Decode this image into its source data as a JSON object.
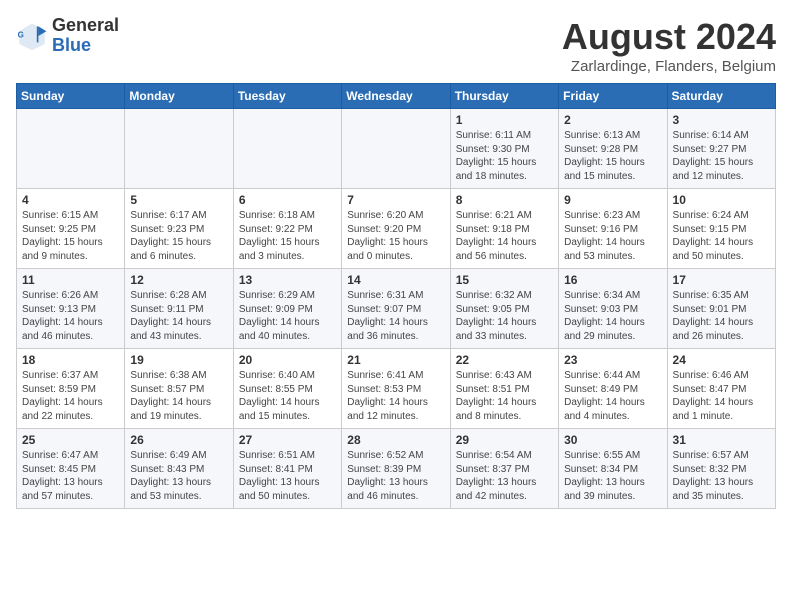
{
  "header": {
    "logo_general": "General",
    "logo_blue": "Blue",
    "month_year": "August 2024",
    "location": "Zarlardinge, Flanders, Belgium"
  },
  "weekdays": [
    "Sunday",
    "Monday",
    "Tuesday",
    "Wednesday",
    "Thursday",
    "Friday",
    "Saturday"
  ],
  "weeks": [
    [
      {
        "day": "",
        "info": ""
      },
      {
        "day": "",
        "info": ""
      },
      {
        "day": "",
        "info": ""
      },
      {
        "day": "",
        "info": ""
      },
      {
        "day": "1",
        "info": "Sunrise: 6:11 AM\nSunset: 9:30 PM\nDaylight: 15 hours and 18 minutes."
      },
      {
        "day": "2",
        "info": "Sunrise: 6:13 AM\nSunset: 9:28 PM\nDaylight: 15 hours and 15 minutes."
      },
      {
        "day": "3",
        "info": "Sunrise: 6:14 AM\nSunset: 9:27 PM\nDaylight: 15 hours and 12 minutes."
      }
    ],
    [
      {
        "day": "4",
        "info": "Sunrise: 6:15 AM\nSunset: 9:25 PM\nDaylight: 15 hours and 9 minutes."
      },
      {
        "day": "5",
        "info": "Sunrise: 6:17 AM\nSunset: 9:23 PM\nDaylight: 15 hours and 6 minutes."
      },
      {
        "day": "6",
        "info": "Sunrise: 6:18 AM\nSunset: 9:22 PM\nDaylight: 15 hours and 3 minutes."
      },
      {
        "day": "7",
        "info": "Sunrise: 6:20 AM\nSunset: 9:20 PM\nDaylight: 15 hours and 0 minutes."
      },
      {
        "day": "8",
        "info": "Sunrise: 6:21 AM\nSunset: 9:18 PM\nDaylight: 14 hours and 56 minutes."
      },
      {
        "day": "9",
        "info": "Sunrise: 6:23 AM\nSunset: 9:16 PM\nDaylight: 14 hours and 53 minutes."
      },
      {
        "day": "10",
        "info": "Sunrise: 6:24 AM\nSunset: 9:15 PM\nDaylight: 14 hours and 50 minutes."
      }
    ],
    [
      {
        "day": "11",
        "info": "Sunrise: 6:26 AM\nSunset: 9:13 PM\nDaylight: 14 hours and 46 minutes."
      },
      {
        "day": "12",
        "info": "Sunrise: 6:28 AM\nSunset: 9:11 PM\nDaylight: 14 hours and 43 minutes."
      },
      {
        "day": "13",
        "info": "Sunrise: 6:29 AM\nSunset: 9:09 PM\nDaylight: 14 hours and 40 minutes."
      },
      {
        "day": "14",
        "info": "Sunrise: 6:31 AM\nSunset: 9:07 PM\nDaylight: 14 hours and 36 minutes."
      },
      {
        "day": "15",
        "info": "Sunrise: 6:32 AM\nSunset: 9:05 PM\nDaylight: 14 hours and 33 minutes."
      },
      {
        "day": "16",
        "info": "Sunrise: 6:34 AM\nSunset: 9:03 PM\nDaylight: 14 hours and 29 minutes."
      },
      {
        "day": "17",
        "info": "Sunrise: 6:35 AM\nSunset: 9:01 PM\nDaylight: 14 hours and 26 minutes."
      }
    ],
    [
      {
        "day": "18",
        "info": "Sunrise: 6:37 AM\nSunset: 8:59 PM\nDaylight: 14 hours and 22 minutes."
      },
      {
        "day": "19",
        "info": "Sunrise: 6:38 AM\nSunset: 8:57 PM\nDaylight: 14 hours and 19 minutes."
      },
      {
        "day": "20",
        "info": "Sunrise: 6:40 AM\nSunset: 8:55 PM\nDaylight: 14 hours and 15 minutes."
      },
      {
        "day": "21",
        "info": "Sunrise: 6:41 AM\nSunset: 8:53 PM\nDaylight: 14 hours and 12 minutes."
      },
      {
        "day": "22",
        "info": "Sunrise: 6:43 AM\nSunset: 8:51 PM\nDaylight: 14 hours and 8 minutes."
      },
      {
        "day": "23",
        "info": "Sunrise: 6:44 AM\nSunset: 8:49 PM\nDaylight: 14 hours and 4 minutes."
      },
      {
        "day": "24",
        "info": "Sunrise: 6:46 AM\nSunset: 8:47 PM\nDaylight: 14 hours and 1 minute."
      }
    ],
    [
      {
        "day": "25",
        "info": "Sunrise: 6:47 AM\nSunset: 8:45 PM\nDaylight: 13 hours and 57 minutes."
      },
      {
        "day": "26",
        "info": "Sunrise: 6:49 AM\nSunset: 8:43 PM\nDaylight: 13 hours and 53 minutes."
      },
      {
        "day": "27",
        "info": "Sunrise: 6:51 AM\nSunset: 8:41 PM\nDaylight: 13 hours and 50 minutes."
      },
      {
        "day": "28",
        "info": "Sunrise: 6:52 AM\nSunset: 8:39 PM\nDaylight: 13 hours and 46 minutes."
      },
      {
        "day": "29",
        "info": "Sunrise: 6:54 AM\nSunset: 8:37 PM\nDaylight: 13 hours and 42 minutes."
      },
      {
        "day": "30",
        "info": "Sunrise: 6:55 AM\nSunset: 8:34 PM\nDaylight: 13 hours and 39 minutes."
      },
      {
        "day": "31",
        "info": "Sunrise: 6:57 AM\nSunset: 8:32 PM\nDaylight: 13 hours and 35 minutes."
      }
    ]
  ]
}
